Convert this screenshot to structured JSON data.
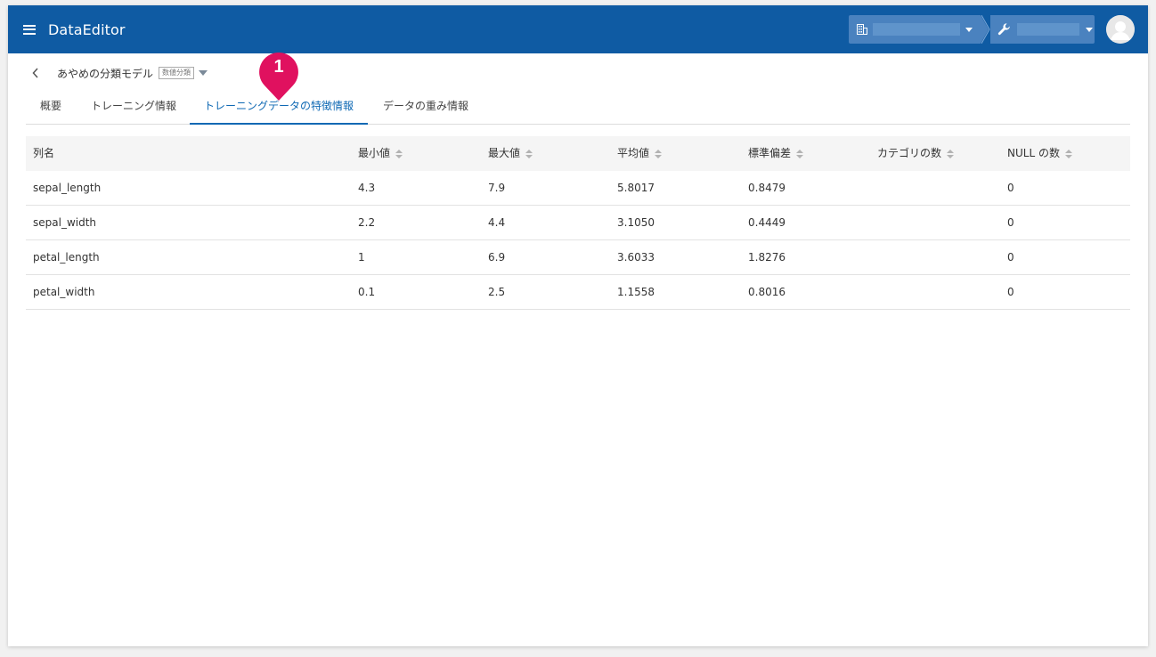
{
  "app": {
    "title": "DataEditor"
  },
  "header": {
    "org_icon": "building-icon",
    "tool_icon": "wrench-icon",
    "menu_icon": "hamburger-menu-icon",
    "avatar_icon": "user-avatar-icon"
  },
  "model": {
    "name": "あやめの分類モデル",
    "badge": "数値分類"
  },
  "tabs": [
    {
      "label": "概要",
      "active": false
    },
    {
      "label": "トレーニング情報",
      "active": false
    },
    {
      "label": "トレーニングデータの特徴情報",
      "active": true
    },
    {
      "label": "データの重み情報",
      "active": false
    }
  ],
  "marker": {
    "number": "1"
  },
  "table": {
    "columns": [
      "列名",
      "最小値",
      "最大値",
      "平均値",
      "標準偏差",
      "カテゴリの数",
      "NULL の数"
    ],
    "rows": [
      [
        "sepal_length",
        "4.3",
        "7.9",
        "5.8017",
        "0.8479",
        "",
        "0"
      ],
      [
        "sepal_width",
        "2.2",
        "4.4",
        "3.1050",
        "0.4449",
        "",
        "0"
      ],
      [
        "petal_length",
        "1",
        "6.9",
        "3.6033",
        "1.8276",
        "",
        "0"
      ],
      [
        "petal_width",
        "0.1",
        "2.5",
        "1.1558",
        "0.8016",
        "",
        "0"
      ]
    ]
  },
  "colors": {
    "header_bg": "#0f5ba3",
    "accent": "#0f69b4",
    "marker": "#e0115f"
  }
}
